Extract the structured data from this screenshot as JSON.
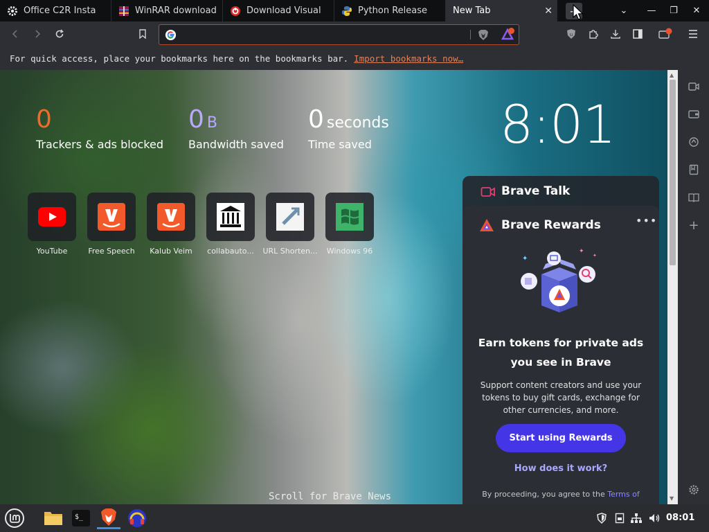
{
  "tabs": [
    {
      "label": "Office C2R Insta",
      "icon": "gear-icon"
    },
    {
      "label": "WinRAR download",
      "icon": "winrar-icon"
    },
    {
      "label": "Download Visual",
      "icon": "download-icon"
    },
    {
      "label": "Python Release",
      "icon": "python-icon"
    },
    {
      "label": "New Tab",
      "icon": "none",
      "active": true
    }
  ],
  "tab_close": "✕",
  "new_tab": "+",
  "window_controls": {
    "list": "⌄",
    "minimize": "—",
    "restore": "❐",
    "close": "✕"
  },
  "url": {
    "value": "",
    "placeholder": ""
  },
  "bookmarks_bar": {
    "message": "For quick access, place your bookmarks here on the bookmarks bar.",
    "link": "Import bookmarks now…"
  },
  "stats": {
    "trackers": {
      "value": "0",
      "label": "Trackers & ads blocked"
    },
    "bandwidth": {
      "value": "0",
      "unit": "B",
      "label": "Bandwidth saved"
    },
    "time": {
      "value": "0",
      "unit": "seconds",
      "label": "Time saved"
    }
  },
  "clock": "8:01",
  "top_sites": [
    {
      "label": "YouTube"
    },
    {
      "label": "Free Speech"
    },
    {
      "label": "Kalub Veim"
    },
    {
      "label": "collabauto..."
    },
    {
      "label": "URL Shorten..."
    },
    {
      "label": "Windows 96"
    }
  ],
  "scroll_news": "Scroll for Brave News",
  "brave_talk": {
    "title": "Brave Talk"
  },
  "brave_rewards": {
    "title": "Brave Rewards",
    "menu": "•••",
    "heading": "Earn tokens for private ads you see in Brave",
    "body": "Support content creators and use your tokens to buy gift cards, exchange for other currencies, and more.",
    "start_button": "Start using Rewards",
    "how_link": "How does it work?",
    "terms_prefix": "By proceeding, you agree to the ",
    "terms_link": "Terms of"
  },
  "taskbar": {
    "clock": "08:01"
  },
  "colors": {
    "accent_orange": "#e0825a",
    "rewards_button": "#4436e6",
    "link_purple": "#a8a8ff"
  }
}
